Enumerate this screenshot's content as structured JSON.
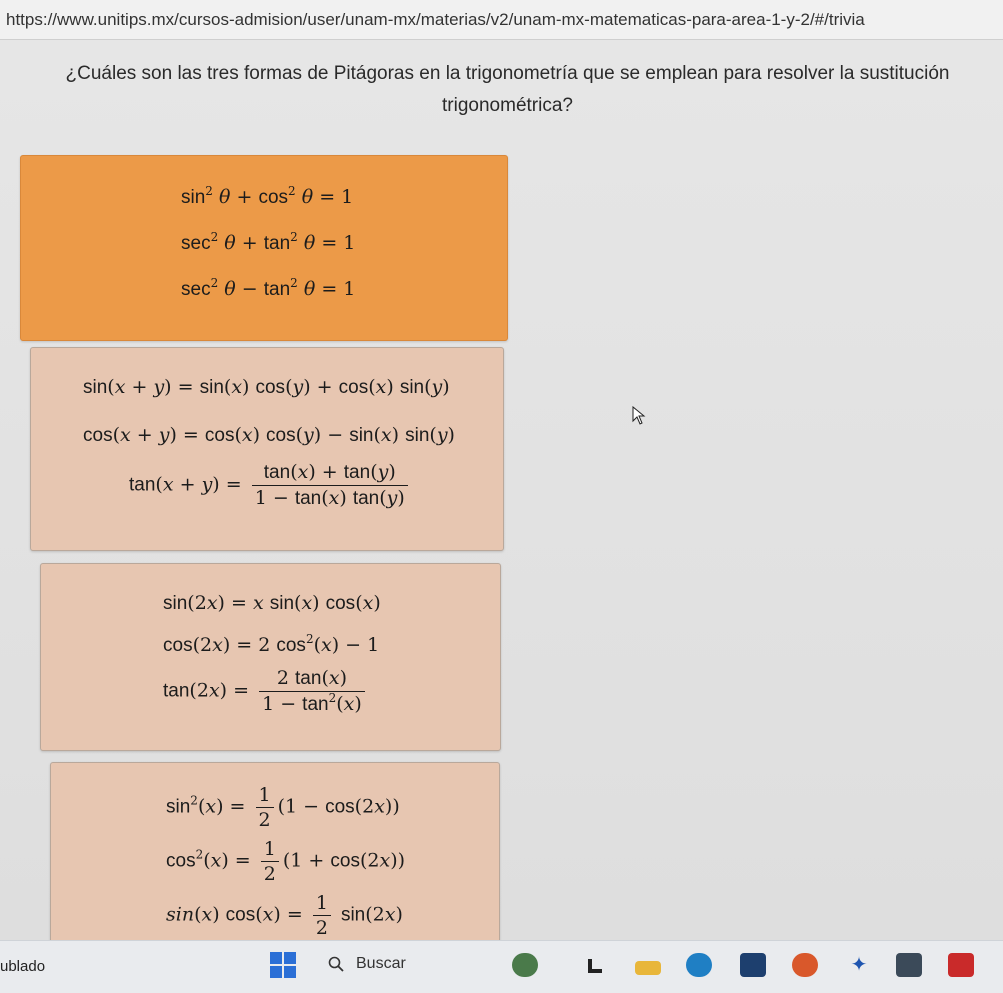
{
  "browser": {
    "url": "https://www.unitips.mx/cursos-admision/user/unam-mx/materias/v2/unam-mx-matematicas-para-area-1-y-2/#/trivia"
  },
  "question": {
    "text": "¿Cuáles son las tres formas de Pitágoras en la trigonometría que se emplean para resolver la sustitución trigonométrica?"
  },
  "options": [
    {
      "selected": true,
      "equations": [
        "sin²θ + cos²θ = 1",
        "sec²θ + tan²θ = 1",
        "sec²θ − tan²θ = 1"
      ]
    },
    {
      "selected": false,
      "equations": [
        "sin(x + y) = sin(x) cos(y) + cos(x) sin(y)",
        "cos(x + y) = cos(x) cos(y) − sin(x) sin(y)",
        "tan(x + y) = (tan(x) + tan(y)) / (1 − tan(x) tan(y))"
      ]
    },
    {
      "selected": false,
      "equations": [
        "sin(2x) = x sin(x) cos(x)",
        "cos(2x) = 2 cos²(x) − 1",
        "tan(2x) = 2 tan(x) / (1 − tan²(x))"
      ]
    },
    {
      "selected": false,
      "equations": [
        "sin²(x) = ½(1 − cos(2x))",
        "cos²(x) = ½(1 + cos(2x))",
        "sin(x) cos(x) = ½ sin(2x)"
      ]
    }
  ],
  "colors": {
    "selected_option": "#ec9a48",
    "option_background": "#e7c6b1",
    "start_blue": "#2b6fd6"
  },
  "taskbar": {
    "weather_text": "ublado",
    "search_label": "Buscar",
    "icons": [
      "weather-icon",
      "start-icon",
      "search-icon",
      "photos-icon",
      "terminal-icon",
      "file-explorer-icon",
      "edge-icon",
      "store-icon",
      "firefox-icon",
      "dropbox-icon",
      "app-icon",
      "acrobat-icon"
    ]
  }
}
